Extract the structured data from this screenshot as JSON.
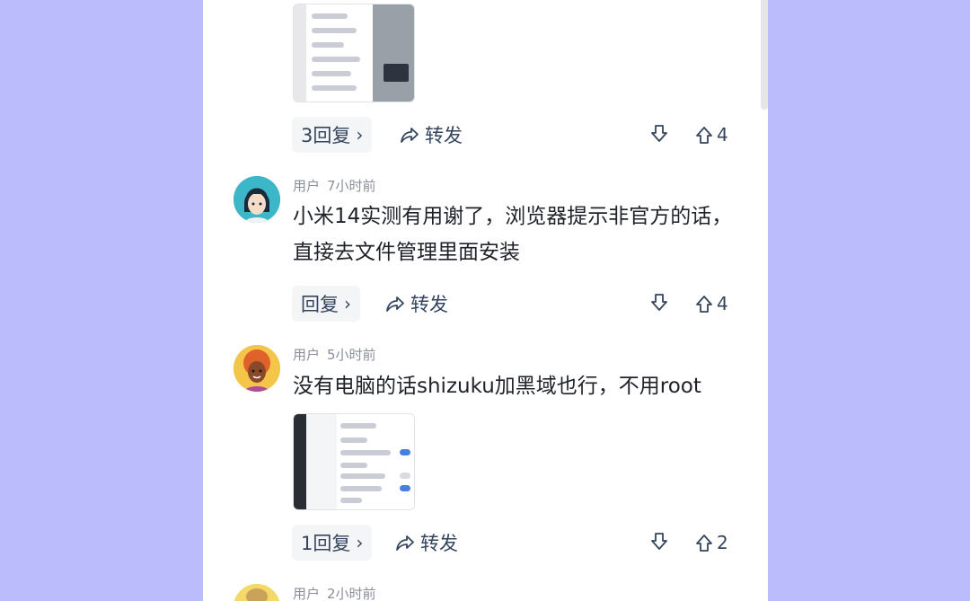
{
  "comments": [
    {
      "actions": {
        "reply_label": "3回复",
        "share_label": "转发",
        "upvotes": "4"
      }
    },
    {
      "user": "用户",
      "time": "7小时前",
      "text": "小米14实测有用谢了，浏览器提示非官方的话，直接去文件管理里面安装",
      "actions": {
        "reply_label": "回复",
        "share_label": "转发",
        "upvotes": "4"
      }
    },
    {
      "user": "用户",
      "time": "5小时前",
      "text": "没有电脑的话shizuku加黑域也行，不用root",
      "actions": {
        "reply_label": "1回复",
        "share_label": "转发",
        "upvotes": "2"
      }
    },
    {
      "user": "用户",
      "time": "2小时前"
    }
  ],
  "colors": {
    "background": "#bbbcfb",
    "panel": "#ffffff",
    "text": "#1f2329",
    "secondary": "#8a8f99",
    "accent": "#4a7de0"
  },
  "icons": {
    "chevron": "chevron-right-icon",
    "share": "share-arrow-icon",
    "downvote": "arrow-down-icon",
    "upvote": "arrow-up-icon"
  }
}
